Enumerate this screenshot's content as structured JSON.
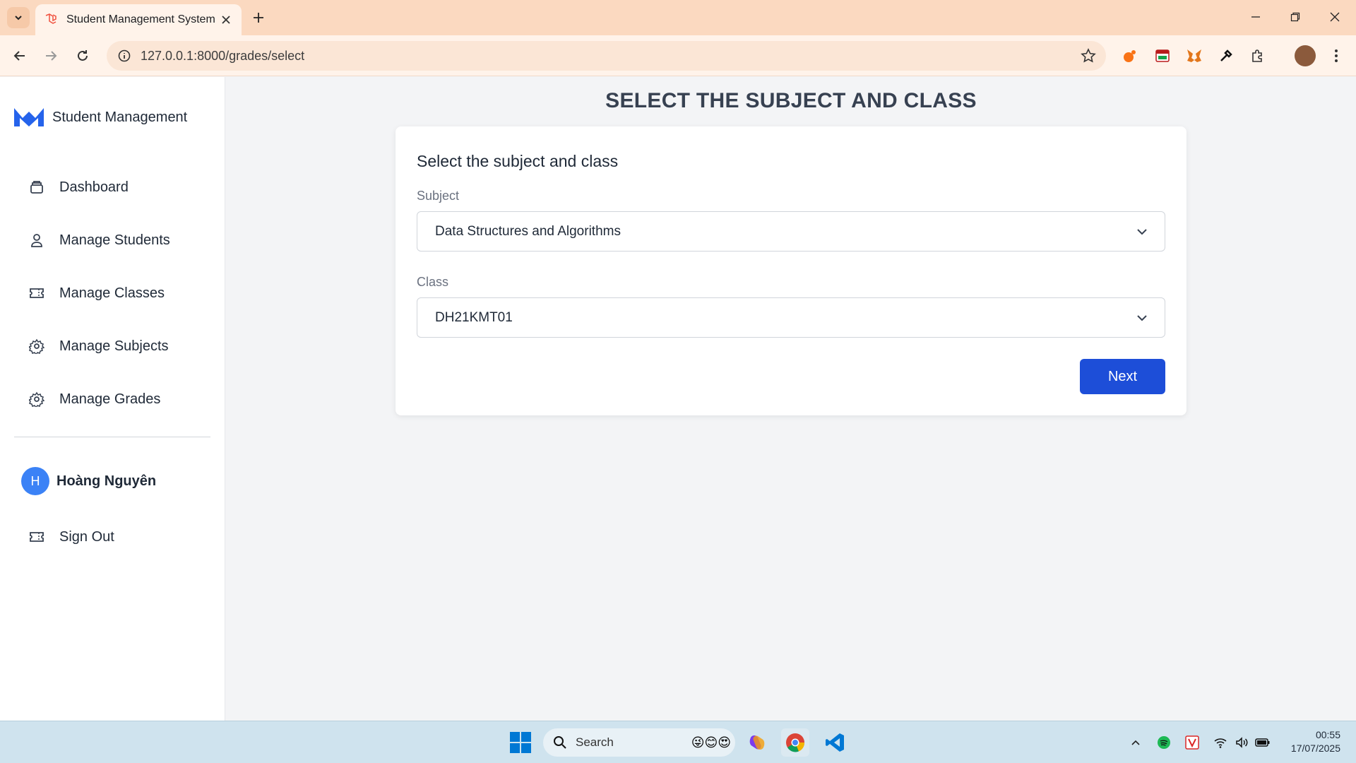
{
  "browser": {
    "tab_title": "Student Management System",
    "url": "127.0.0.1:8000/grades/select"
  },
  "sidebar": {
    "brand": "Student Management",
    "items": [
      {
        "label": "Dashboard",
        "icon": "dashboard-icon"
      },
      {
        "label": "Manage Students",
        "icon": "user-icon"
      },
      {
        "label": "Manage Classes",
        "icon": "ticket-icon"
      },
      {
        "label": "Manage Subjects",
        "icon": "gear-icon"
      },
      {
        "label": "Manage Grades",
        "icon": "gear-icon"
      }
    ],
    "user": {
      "initial": "H",
      "name": "Hoàng Nguyên"
    },
    "sign_out": "Sign Out"
  },
  "main": {
    "page_title": "SELECT THE SUBJECT AND CLASS",
    "card_title": "Select the subject and class",
    "subject": {
      "label": "Subject",
      "value": "Data Structures and Algorithms"
    },
    "class": {
      "label": "Class",
      "value": "DH21KMT01"
    },
    "next_label": "Next"
  },
  "taskbar": {
    "search_label": "Search",
    "time": "00:55",
    "date": "17/07/2025"
  },
  "colors": {
    "accent": "#1d4ed8",
    "avatar": "#3b82f6",
    "tabstrip": "#fbd9c0",
    "background": "#f3f4f6"
  }
}
